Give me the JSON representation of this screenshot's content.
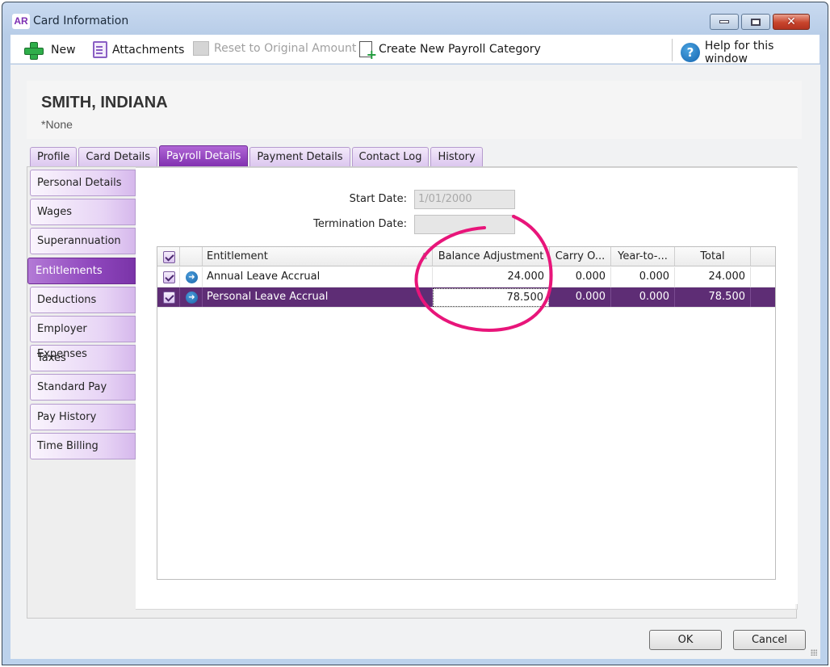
{
  "window": {
    "app_badge": "AR",
    "title": "Card Information"
  },
  "toolbar": {
    "new_label": "New",
    "attachments_label": "Attachments",
    "reset_label": "Reset to Original Amount",
    "create_category_label": "Create New Payroll Category",
    "help_label": "Help for this window"
  },
  "header": {
    "card_name": "SMITH, INDIANA",
    "card_subtitle": "*None"
  },
  "tabs": [
    {
      "label": "Profile",
      "active": false
    },
    {
      "label": "Card Details",
      "active": false
    },
    {
      "label": "Payroll Details",
      "active": true
    },
    {
      "label": "Payment Details",
      "active": false
    },
    {
      "label": "Contact Log",
      "active": false
    },
    {
      "label": "History",
      "active": false
    }
  ],
  "side_nav": [
    {
      "label": "Personal Details",
      "active": false
    },
    {
      "label": "Wages",
      "active": false
    },
    {
      "label": "Superannuation",
      "active": false
    },
    {
      "label": "Entitlements",
      "active": true
    },
    {
      "label": "Deductions",
      "active": false
    },
    {
      "label": "Employer Expenses",
      "active": false
    },
    {
      "label": "Taxes",
      "active": false
    },
    {
      "label": "Standard Pay",
      "active": false
    },
    {
      "label": "Pay History",
      "active": false
    },
    {
      "label": "Time Billing",
      "active": false
    }
  ],
  "form": {
    "start_date_label": "Start Date:",
    "start_date_value": "1/01/2000",
    "termination_date_label": "Termination Date:",
    "termination_date_value": ""
  },
  "grid": {
    "columns": [
      "",
      "",
      "Entitlement",
      "Balance Adjustment",
      "Carry O...",
      "Year-to-...",
      "Total"
    ],
    "sort_indicator": "Δ",
    "rows": [
      {
        "checked": true,
        "name": "Annual Leave Accrual",
        "balance_adjustment": "24.000",
        "carry_over": "0.000",
        "year_to_date": "0.000",
        "total": "24.000",
        "selected": false
      },
      {
        "checked": true,
        "name": "Personal Leave Accrual",
        "balance_adjustment": "78.500",
        "carry_over": "0.000",
        "year_to_date": "0.000",
        "total": "78.500",
        "selected": true
      }
    ]
  },
  "colors": {
    "accent_purple": "#8131b0",
    "selected_row": "#5e2d75",
    "annotation_pink": "#e8157a"
  },
  "footer": {
    "ok_label": "OK",
    "cancel_label": "Cancel"
  }
}
